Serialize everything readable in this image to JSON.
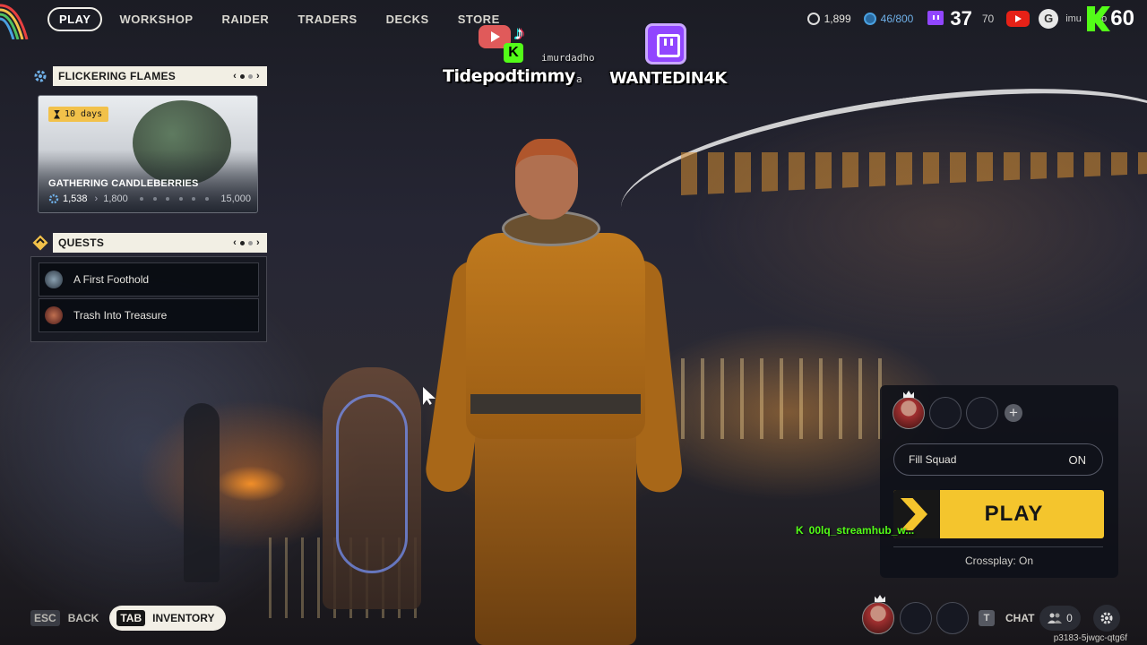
{
  "nav": {
    "items": [
      {
        "label": "PLAY",
        "active": true
      },
      {
        "label": "WORKSHOP",
        "active": false
      },
      {
        "label": "RAIDER",
        "active": false
      },
      {
        "label": "TRADERS",
        "active": false
      },
      {
        "label": "DECKS",
        "active": false
      },
      {
        "label": "STORE",
        "active": false
      }
    ]
  },
  "stats": {
    "coins": "1,899",
    "raider_tokens": "46/800",
    "partial_value": "70",
    "level": "37",
    "username_partial": "imu",
    "username_tail": "dho",
    "kick_level": "60"
  },
  "overlay": {
    "name_left": "Tidepodtimmy",
    "name_left_suffix": "a",
    "handle": "imurdadho",
    "name_right": "WANTEDIN4K"
  },
  "event": {
    "section_title": "FLICKERING FLAMES",
    "days_badge": "10 days",
    "name": "GATHERING CANDLEBERRIES",
    "current": "1,538",
    "milestone": "1,800",
    "goal": "15,000"
  },
  "quests": {
    "section_title": "QUESTS",
    "items": [
      {
        "label": "A First Foothold"
      },
      {
        "label": "Trash Into Treasure"
      }
    ]
  },
  "squad": {
    "fill_squad_label": "Fill Squad",
    "fill_squad_value": "ON",
    "play_label": "PLAY",
    "crossplay": "Crossplay: On"
  },
  "chat_overlay": {
    "message": "00lq_streamhub_w..."
  },
  "bottom": {
    "esc_key": "ESC",
    "back_label": "BACK",
    "tab_key": "TAB",
    "inventory_label": "INVENTORY",
    "chat_key": "T",
    "chat_label": "CHAT",
    "friends_count": "0"
  },
  "session_id": "p3183-5jwgc-qtg6f",
  "colors": {
    "accent_yellow": "#f4c52d",
    "kick_green": "#53fc18",
    "twitch_purple": "#9146ff",
    "panel_header": "#f2efe4"
  }
}
